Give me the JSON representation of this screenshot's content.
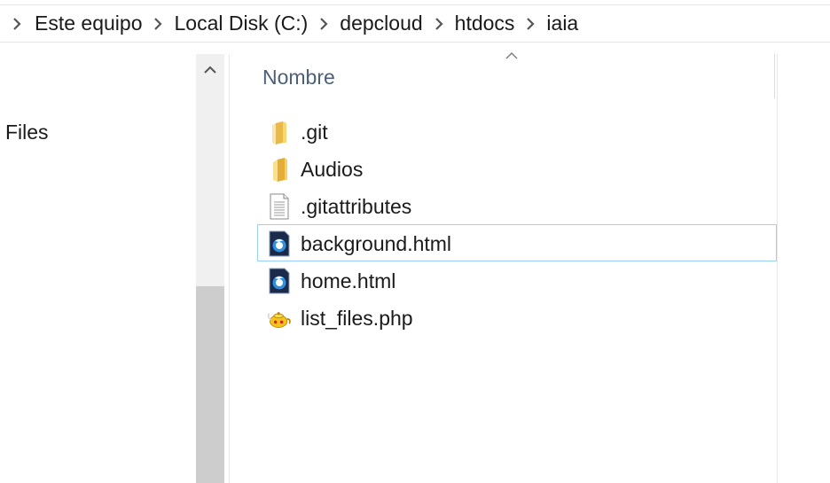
{
  "breadcrumb": {
    "items": [
      {
        "label": "Este equipo"
      },
      {
        "label": "Local Disk (C:)"
      },
      {
        "label": "depcloud"
      },
      {
        "label": "htdocs"
      },
      {
        "label": "iaia"
      }
    ]
  },
  "nav_pane": {
    "label": "Files"
  },
  "columns": {
    "name_header": "Nombre"
  },
  "files": [
    {
      "name": ".git",
      "icon": "folder-icon",
      "selected": false
    },
    {
      "name": "Audios",
      "icon": "folder-icon",
      "selected": false
    },
    {
      "name": ".gitattributes",
      "icon": "text-file-icon",
      "selected": false
    },
    {
      "name": "background.html",
      "icon": "html-file-icon",
      "selected": true
    },
    {
      "name": "home.html",
      "icon": "html-file-icon",
      "selected": false
    },
    {
      "name": "list_files.php",
      "icon": "php-file-icon",
      "selected": false
    }
  ],
  "colors": {
    "selection_border": "#99d1ff",
    "header_text": "#4c607a",
    "scrollbar_track": "#f0f0f0",
    "scrollbar_thumb": "#cdcdcd",
    "folder": "#f7d774"
  }
}
